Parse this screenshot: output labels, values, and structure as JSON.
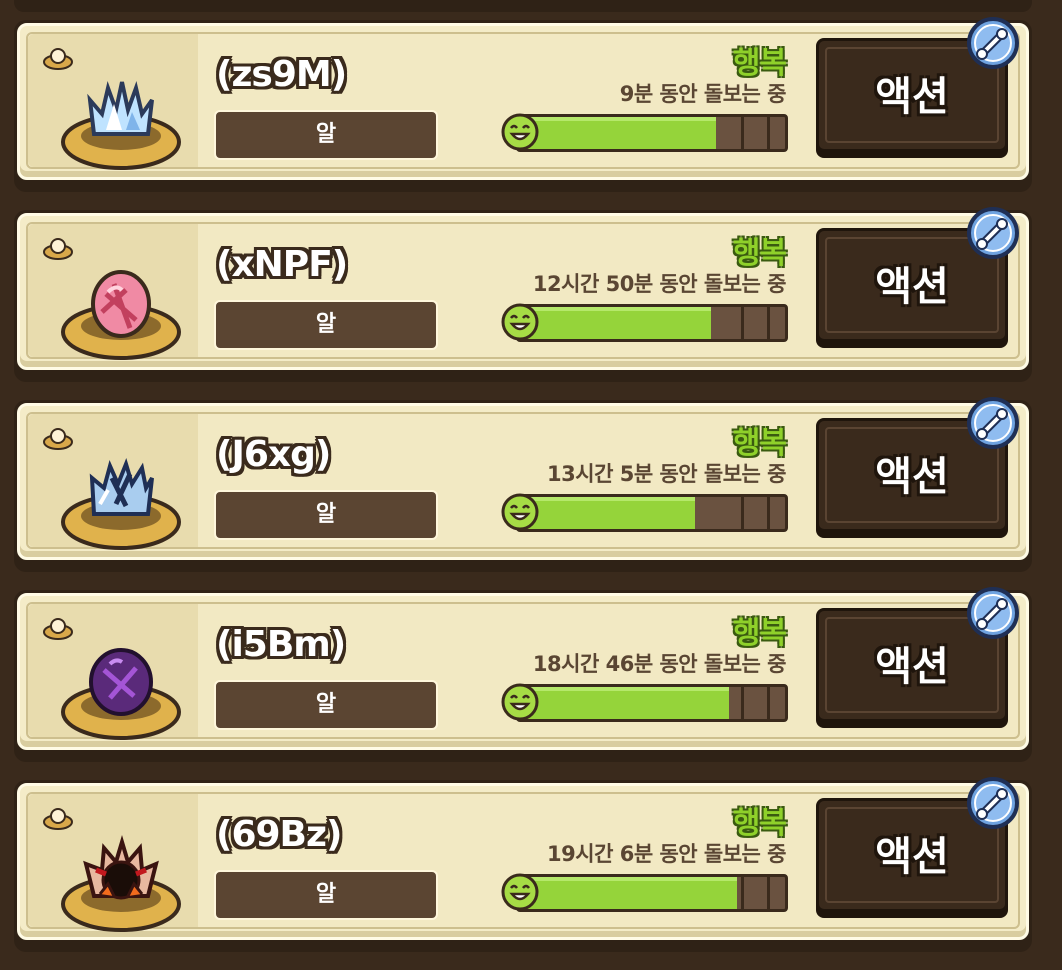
{
  "colors": {
    "background": "#3a2a1c",
    "card": "#f4ecc8",
    "mood": "#8fd12a",
    "bar_fill": "#95d43a",
    "button": "#3a2a1c"
  },
  "pets": [
    {
      "name": "(zs9M)",
      "stage": "알",
      "mood": "행복",
      "care_text": "9분 동안 돌보는 중",
      "happiness_fraction": 0.74,
      "creature_icon": "ice-crystal-egg-icon",
      "action_label": "액션"
    },
    {
      "name": "(xNPF)",
      "stage": "알",
      "mood": "행복",
      "care_text": "12시간 50분 동안 돌보는 중",
      "happiness_fraction": 0.72,
      "creature_icon": "pink-leaf-egg-icon",
      "action_label": "액션"
    },
    {
      "name": "(J6xg)",
      "stage": "알",
      "mood": "행복",
      "care_text": "13시간 5분 동안 돌보는 중",
      "happiness_fraction": 0.66,
      "creature_icon": "cracked-ice-egg-icon",
      "action_label": "액션"
    },
    {
      "name": "(i5Bm)",
      "stage": "알",
      "mood": "행복",
      "care_text": "18시간 46분 동안 돌보는 중",
      "happiness_fraction": 0.79,
      "creature_icon": "purple-egg-icon",
      "action_label": "액션"
    },
    {
      "name": "(69Bz)",
      "stage": "알",
      "mood": "행복",
      "care_text": "19시간 6분 동안 돌보는 중",
      "happiness_fraction": 0.82,
      "creature_icon": "fire-spiky-egg-icon",
      "action_label": "액션"
    }
  ]
}
